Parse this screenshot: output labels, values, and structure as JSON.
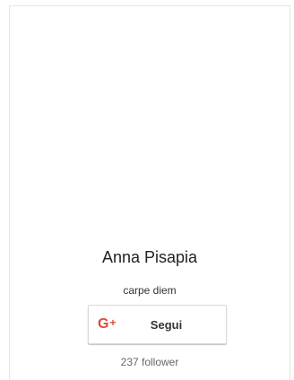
{
  "profile": {
    "name": "Anna Pisapia",
    "tagline": "carpe diem",
    "follow_button": {
      "icon": "google-plus-icon",
      "icon_text": "G",
      "icon_plus": "+",
      "label": "Segui"
    },
    "followers_text": "237 follower"
  },
  "colors": {
    "google_red": "#dd4b39",
    "border": "#e5e5e5"
  }
}
